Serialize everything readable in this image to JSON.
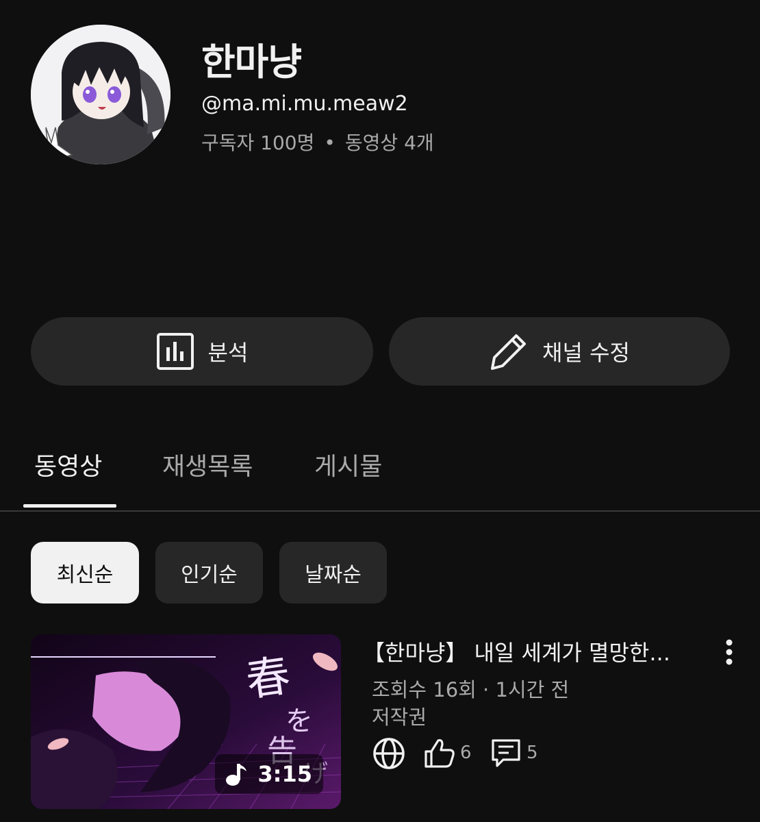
{
  "channel": {
    "name": "한마냥",
    "handle": "@ma.mi.mu.meaw2",
    "subscribers": "구독자 100명",
    "separator": "•",
    "video_count": "동영상 4개"
  },
  "actions": {
    "analytics_label": "분석",
    "edit_label": "채널 수정"
  },
  "tabs": [
    {
      "label": "동영상",
      "active": true
    },
    {
      "label": "재생목록",
      "active": false
    },
    {
      "label": "게시물",
      "active": false
    }
  ],
  "sort_chips": [
    {
      "label": "최신순",
      "active": true
    },
    {
      "label": "인기순",
      "active": false
    },
    {
      "label": "날짜순",
      "active": false
    }
  ],
  "video": {
    "title": "【한마냥】 내일 세계가 멸망한...",
    "views_time": "조회수 16회 · 1시간 전",
    "copyright": "저작권",
    "duration": "3:15",
    "likes": "6",
    "comments": "5",
    "thumbnail_text": "春を告げる",
    "visibility_icon": "globe-icon"
  },
  "colors": {
    "background": "#0f0f0f",
    "surface": "#272727",
    "text_primary": "#f1f1f1",
    "text_secondary": "#aaaaaa",
    "thumb_accent": "#c86ad8"
  }
}
